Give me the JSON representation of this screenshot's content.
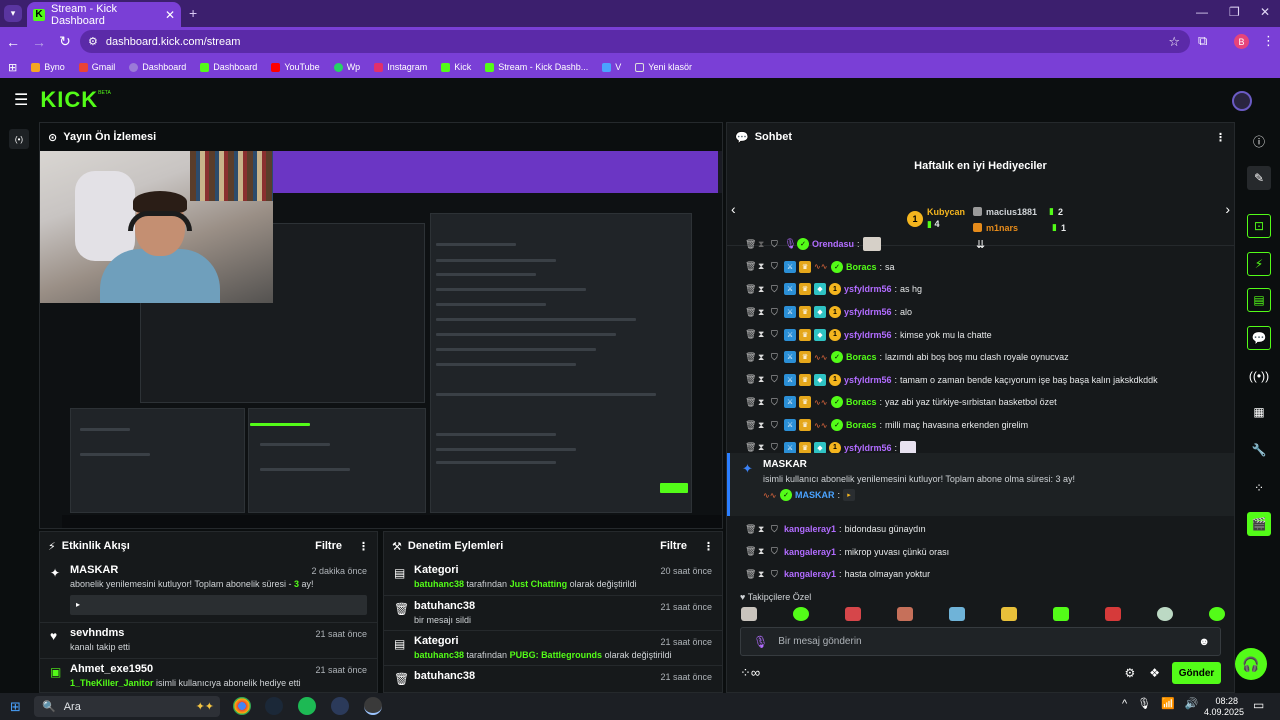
{
  "browser": {
    "tab_title": "Stream - Kick Dashboard",
    "url": "dashboard.kick.com/stream",
    "profile_initial": "B",
    "bookmarks": [
      {
        "label": "Byno",
        "color": "#f5a623"
      },
      {
        "label": "Gmail",
        "color": "#ea4335"
      },
      {
        "label": "Dashboard",
        "color": "#9b7ad8"
      },
      {
        "label": "Dashboard",
        "color": "#53fc18"
      },
      {
        "label": "YouTube",
        "color": "#ff0000"
      },
      {
        "label": "Wp",
        "color": "#25d366"
      },
      {
        "label": "Instagram",
        "color": "#e1306c"
      },
      {
        "label": "Kick",
        "color": "#53fc18"
      },
      {
        "label": "Stream - Kick Dashb...",
        "color": "#53fc18"
      },
      {
        "label": "V",
        "color": "#4aa3ff"
      },
      {
        "label": "Yeni klasör",
        "color": "#cccccc"
      }
    ]
  },
  "kick": {
    "logo": "KICK",
    "beta": "BETA",
    "live_badge": "(•)"
  },
  "preview": {
    "title": "Yayın Ön İzlemesi"
  },
  "activity": {
    "title": "Etkinlik Akışı",
    "filter": "Filtre",
    "items": [
      {
        "name": "MASKAR",
        "desc_pre": "abonelik yenilemesini kutluyor! Toplam abonelik süresi - ",
        "desc_num": "3",
        "desc_post": " ay!",
        "time": "2 dakika önce",
        "box": "▸"
      },
      {
        "name": "sevhndms",
        "desc": "kanalı takip etti",
        "time": "21 saat önce"
      },
      {
        "name": "Ahmet_exe1950",
        "desc_user": "1_TheKiller_Janitor",
        "desc": " isimli kullanıcıya abonelik hediye etti",
        "time": "21 saat önce"
      }
    ]
  },
  "moderation": {
    "title": "Denetim Eylemleri",
    "filter": "Filtre",
    "items": [
      {
        "title": "Kategori",
        "user": "batuhanc38",
        "mid": " tarafından ",
        "cat": "Just Chatting",
        "end": " olarak değiştirildi",
        "time": "20 saat önce"
      },
      {
        "title": "batuhanc38",
        "desc": "bir mesajı sildi",
        "time": "21 saat önce"
      },
      {
        "title": "Kategori",
        "user": "batuhanc38",
        "mid": " tarafından ",
        "cat": "PUBG: Battlegrounds",
        "end": " olarak değiştirildi",
        "time": "21 saat önce"
      },
      {
        "title": "batuhanc38",
        "time": "21 saat önce"
      }
    ]
  },
  "chat": {
    "title": "Sohbet",
    "gifters_title": "Haftalık en iyi Hediyeciler",
    "gifters": [
      {
        "rank": "1",
        "name": "Kubycan",
        "count": "4"
      },
      {
        "name": "macius1881",
        "count": "2"
      },
      {
        "name": "m1nars",
        "count": "1"
      }
    ],
    "messages": [
      {
        "user": "Orendasu",
        "color": "purple",
        "text": "",
        "emote": true
      },
      {
        "user": "Boracs",
        "color": "green",
        "text": "sa"
      },
      {
        "user": "ysfyldrm56",
        "color": "purple",
        "text": "as hg"
      },
      {
        "user": "ysfyldrm56",
        "color": "purple",
        "text": "alo"
      },
      {
        "user": "ysfyldrm56",
        "color": "purple",
        "text": "kimse yok mu la chatte"
      },
      {
        "user": "Boracs",
        "color": "green",
        "text": "lazımdı abi boş boş mu clash royale oynucvaz"
      },
      {
        "user": "ysfyldrm56",
        "color": "purple",
        "text": "tamam o zaman bende kaçıyorum işe baş başa kalın jakskdkddk"
      },
      {
        "user": "Boracs",
        "color": "green",
        "text": "yaz abi yaz türkiye-sırbistan basketbol özet"
      },
      {
        "user": "Boracs",
        "color": "green",
        "text": "milli maç havasına erkenden girelim"
      },
      {
        "user": "ysfyldrm56",
        "color": "purple",
        "text": "",
        "emote": true
      }
    ],
    "sub_notice": {
      "name": "MASKAR",
      "text": "isimli kullanıcı abonelik yenilemesini kutluyor! Toplam abone olma süresi: 3 ay!",
      "user": "MASKAR"
    },
    "lower_messages": [
      {
        "user": "kangaleray1",
        "text": "bidondasu günaydın"
      },
      {
        "user": "kangaleray1",
        "text": "mikrop yuvası çünkü orası"
      },
      {
        "user": "kangaleray1",
        "text": "hasta olmayan yoktur"
      }
    ],
    "follower_label": "Takipçilere Özel",
    "input_placeholder": "Bir mesaj gönderin",
    "send_label": "Gönder"
  },
  "taskbar": {
    "search_placeholder": "Ara",
    "time": "08:28",
    "date": "4.09.2025"
  }
}
